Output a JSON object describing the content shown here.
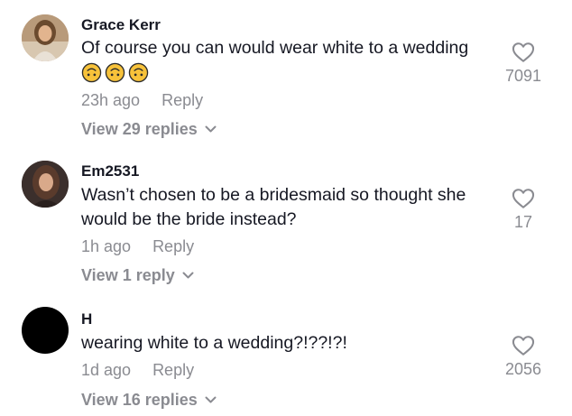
{
  "comments": [
    {
      "username": "Grace Kerr",
      "text": "Of course you can would wear white to a wedding",
      "emojis": [
        "upside-down-face",
        "upside-down-face",
        "upside-down-face"
      ],
      "time": "23h ago",
      "reply_label": "Reply",
      "view_replies": "View 29 replies",
      "likes": "7091"
    },
    {
      "username": "Em2531",
      "text": "Wasn’t chosen to be a bridesmaid so thought she would be the bride instead?",
      "time": "1h ago",
      "reply_label": "Reply",
      "view_replies": "View 1 reply",
      "likes": "17"
    },
    {
      "username": "H",
      "text": "wearing white to a wedding?!??!?!",
      "time": "1d ago",
      "reply_label": "Reply",
      "view_replies": "View 16 replies",
      "likes": "2056"
    }
  ],
  "colors": {
    "text": "#161823",
    "muted": "#8a8b91",
    "background": "#ffffff",
    "emoji": "#f7c23a"
  }
}
